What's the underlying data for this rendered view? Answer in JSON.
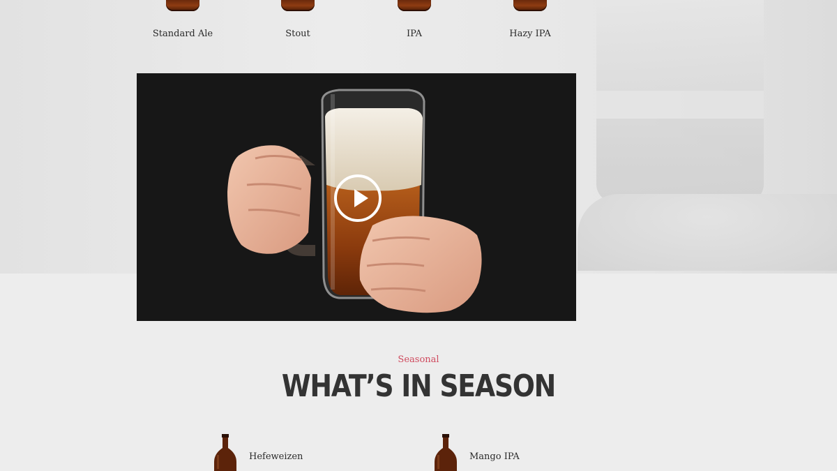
{
  "beer_styles": [
    {
      "label": "Standard Ale"
    },
    {
      "label": "Stout"
    },
    {
      "label": "IPA"
    },
    {
      "label": "Hazy IPA"
    }
  ],
  "video": {
    "play_icon": "play-icon"
  },
  "seasonal": {
    "eyebrow": "Seasonal",
    "heading": "WHAT’S IN SEASON",
    "items": [
      {
        "name": "Hefeweizen"
      },
      {
        "name": "Mango IPA"
      }
    ]
  },
  "colors": {
    "accent": "#cf4a5e",
    "heading": "#333333",
    "bottle": "#6b2a0c"
  }
}
